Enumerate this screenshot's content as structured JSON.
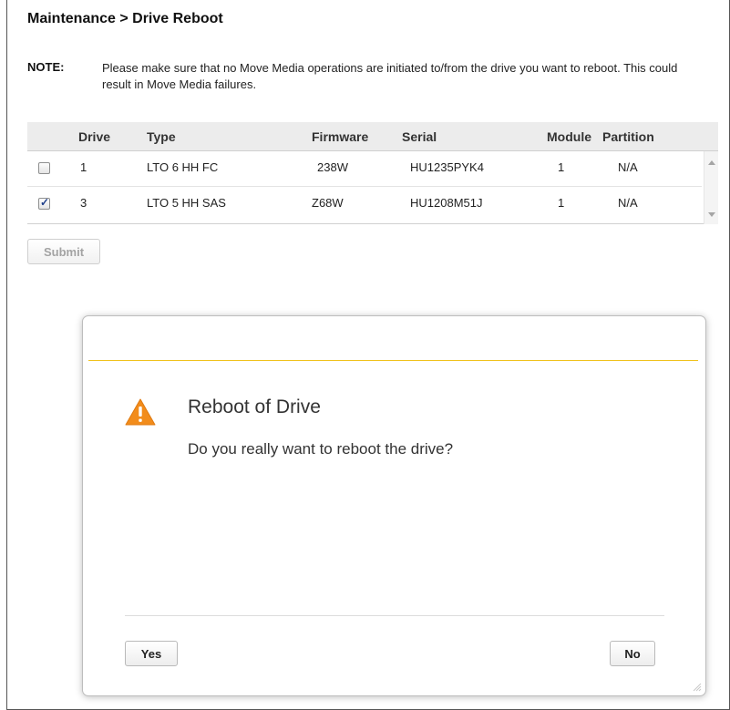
{
  "page": {
    "title": "Maintenance > Drive Reboot",
    "note_label": "NOTE:",
    "note_text": "Please make sure that no Move Media operations are initiated to/from the drive you want to reboot. This could result in Move Media failures."
  },
  "table": {
    "columns": [
      "Drive",
      "Type",
      "Firmware",
      "Serial",
      "Module",
      "Partition"
    ],
    "rows": [
      {
        "checked": false,
        "drive": "1",
        "type": "LTO 6 HH FC",
        "firmware": "238W",
        "serial": "HU1235PYK4",
        "module": "1",
        "partition": "N/A"
      },
      {
        "checked": true,
        "drive": "3",
        "type": "LTO 5 HH SAS",
        "firmware": "Z68W",
        "serial": "HU1208M51J",
        "module": "1",
        "partition": "N/A"
      }
    ]
  },
  "submit_label": "Submit",
  "dialog": {
    "title": "Reboot of Drive",
    "message": "Do you really want to reboot the drive?",
    "yes_label": "Yes",
    "no_label": "No",
    "icon": "warning-icon"
  },
  "colors": {
    "accent_line": "#f0c21c",
    "warning_icon": "#f28c1b"
  }
}
